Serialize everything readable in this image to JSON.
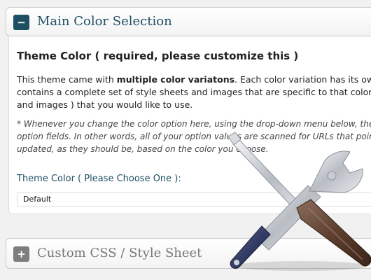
{
  "main_panel": {
    "toggle_symbol": "−",
    "title": "Main Color Selection",
    "section_title": "Theme Color ( required, please customize this )",
    "description": {
      "line1_prefix": "This theme came with ",
      "line1_bold": "multiple color variatons",
      "line1_suffix": ". Each color variation has its own",
      "line2": "contains a complete set of style sheets and images that are specific to that color",
      "line3": "and images ) that you would like to use."
    },
    "note": {
      "line1": "* Whenever you change the color option here, using the drop-down menu below, the",
      "line2": "option fields. In other words, all of your option values are scanned for URLs that point",
      "line3": "updated, as they should be, based on the color you choose."
    },
    "field_label": "Theme Color ( Please Choose One ):",
    "select_value": "Default"
  },
  "second_panel": {
    "toggle_symbol": "+",
    "title": "Custom CSS / Style Sheet"
  },
  "overlay_image": "wrench-and-screwdriver-icon",
  "colors": {
    "title_color": "#1f4f62",
    "toggle_open": "#1f4f62",
    "toggle_closed": "#7d7d7d"
  }
}
